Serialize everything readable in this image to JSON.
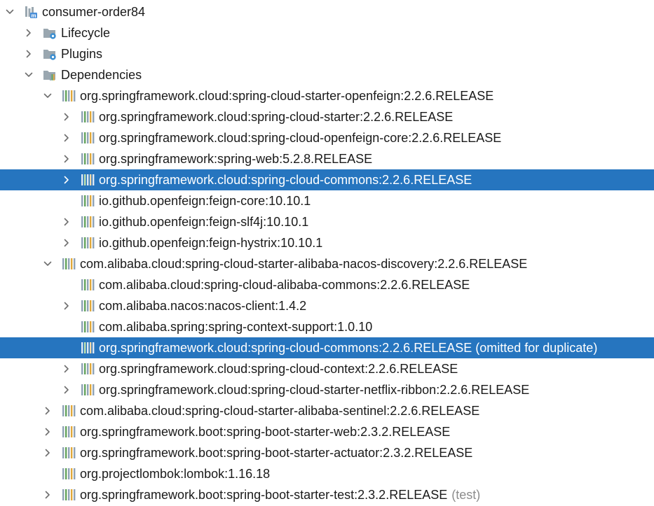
{
  "tree": {
    "rows": [
      {
        "label": "consumer-order84",
        "depth": 0,
        "arrow": "down",
        "icon": "module",
        "suffix": "",
        "selected": false
      },
      {
        "label": "Lifecycle",
        "depth": 1,
        "arrow": "right",
        "icon": "folder-gear",
        "suffix": "",
        "selected": false
      },
      {
        "label": "Plugins",
        "depth": 1,
        "arrow": "right",
        "icon": "folder-gear",
        "suffix": "",
        "selected": false
      },
      {
        "label": "Dependencies",
        "depth": 1,
        "arrow": "down",
        "icon": "folder-library",
        "suffix": "",
        "selected": false
      },
      {
        "label": "org.springframework.cloud:spring-cloud-starter-openfeign:2.2.6.RELEASE",
        "depth": 2,
        "arrow": "down",
        "icon": "library",
        "suffix": "",
        "selected": false
      },
      {
        "label": "org.springframework.cloud:spring-cloud-starter:2.2.6.RELEASE",
        "depth": 3,
        "arrow": "right",
        "icon": "library",
        "suffix": "",
        "selected": false
      },
      {
        "label": "org.springframework.cloud:spring-cloud-openfeign-core:2.2.6.RELEASE",
        "depth": 3,
        "arrow": "right",
        "icon": "library",
        "suffix": "",
        "selected": false
      },
      {
        "label": "org.springframework:spring-web:5.2.8.RELEASE",
        "depth": 3,
        "arrow": "right",
        "icon": "library",
        "suffix": "",
        "selected": false
      },
      {
        "label": "org.springframework.cloud:spring-cloud-commons:2.2.6.RELEASE",
        "depth": 3,
        "arrow": "right",
        "icon": "library",
        "suffix": "",
        "selected": true
      },
      {
        "label": "io.github.openfeign:feign-core:10.10.1",
        "depth": 3,
        "arrow": "none",
        "icon": "library",
        "suffix": "",
        "selected": false
      },
      {
        "label": "io.github.openfeign:feign-slf4j:10.10.1",
        "depth": 3,
        "arrow": "right",
        "icon": "library",
        "suffix": "",
        "selected": false
      },
      {
        "label": "io.github.openfeign:feign-hystrix:10.10.1",
        "depth": 3,
        "arrow": "right",
        "icon": "library",
        "suffix": "",
        "selected": false
      },
      {
        "label": "com.alibaba.cloud:spring-cloud-starter-alibaba-nacos-discovery:2.2.6.RELEASE",
        "depth": 2,
        "arrow": "down",
        "icon": "library",
        "suffix": "",
        "selected": false
      },
      {
        "label": "com.alibaba.cloud:spring-cloud-alibaba-commons:2.2.6.RELEASE",
        "depth": 3,
        "arrow": "none",
        "icon": "library",
        "suffix": "",
        "selected": false
      },
      {
        "label": "com.alibaba.nacos:nacos-client:1.4.2",
        "depth": 3,
        "arrow": "right",
        "icon": "library",
        "suffix": "",
        "selected": false
      },
      {
        "label": "com.alibaba.spring:spring-context-support:1.0.10",
        "depth": 3,
        "arrow": "none",
        "icon": "library",
        "suffix": "",
        "selected": false
      },
      {
        "label": "org.springframework.cloud:spring-cloud-commons:2.2.6.RELEASE (omitted for duplicate)",
        "depth": 3,
        "arrow": "none",
        "icon": "library",
        "suffix": "",
        "selected": true
      },
      {
        "label": "org.springframework.cloud:spring-cloud-context:2.2.6.RELEASE",
        "depth": 3,
        "arrow": "right",
        "icon": "library",
        "suffix": "",
        "selected": false
      },
      {
        "label": "org.springframework.cloud:spring-cloud-starter-netflix-ribbon:2.2.6.RELEASE",
        "depth": 3,
        "arrow": "right",
        "icon": "library",
        "suffix": "",
        "selected": false
      },
      {
        "label": "com.alibaba.cloud:spring-cloud-starter-alibaba-sentinel:2.2.6.RELEASE",
        "depth": 2,
        "arrow": "right",
        "icon": "library",
        "suffix": "",
        "selected": false
      },
      {
        "label": "org.springframework.boot:spring-boot-starter-web:2.3.2.RELEASE",
        "depth": 2,
        "arrow": "right",
        "icon": "library",
        "suffix": "",
        "selected": false
      },
      {
        "label": "org.springframework.boot:spring-boot-starter-actuator:2.3.2.RELEASE",
        "depth": 2,
        "arrow": "right",
        "icon": "library",
        "suffix": "",
        "selected": false
      },
      {
        "label": "org.projectlombok:lombok:1.16.18",
        "depth": 2,
        "arrow": "none",
        "icon": "library",
        "suffix": "",
        "selected": false
      },
      {
        "label": "org.springframework.boot:spring-boot-starter-test:2.3.2.RELEASE",
        "depth": 2,
        "arrow": "right",
        "icon": "library",
        "suffix": "(test)",
        "selected": false
      }
    ]
  },
  "colors": {
    "selection": "#2675bf",
    "text": "#1a1a1a",
    "muted": "#8c8c8c",
    "folder": "#9aa7b0",
    "module_blue": "#4a8fd8",
    "gear": "#3d8fd1"
  }
}
